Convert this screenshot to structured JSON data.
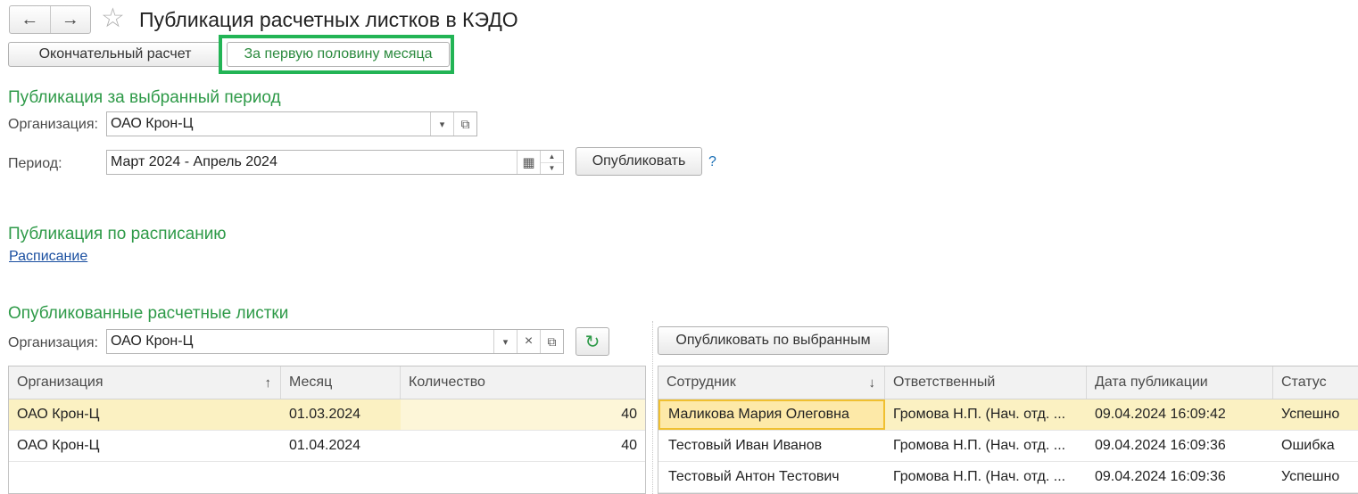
{
  "header": {
    "back": "←",
    "forward": "→",
    "star": "☆",
    "title": "Публикация расчетных листков в КЭДО"
  },
  "tabs": [
    {
      "label": "Окончательный расчет"
    },
    {
      "label": "За первую половину месяца"
    }
  ],
  "period_section": {
    "title": "Публикация за выбранный период",
    "org_label": "Организация:",
    "org_value": "ОАО Крон-Ц",
    "period_label": "Период:",
    "period_value": "Март 2024 - Апрель 2024",
    "publish_button": "Опубликовать",
    "help": "?"
  },
  "schedule_section": {
    "title": "Публикация по расписанию",
    "link": "Расписание"
  },
  "published_section": {
    "title": "Опубликованные расчетные листки",
    "org_label": "Организация:",
    "org_value": "ОАО Крон-Ц",
    "publish_selected_button": "Опубликовать по выбранным"
  },
  "left_table": {
    "columns": [
      "Организация",
      "Месяц",
      "Количество"
    ],
    "sort_marker": "↑",
    "rows": [
      {
        "org": "ОАО Крон-Ц",
        "month": "01.03.2024",
        "count": "40"
      },
      {
        "org": "ОАО Крон-Ц",
        "month": "01.04.2024",
        "count": "40"
      }
    ]
  },
  "right_table": {
    "columns": [
      "Сотрудник",
      "Ответственный",
      "Дата публикации",
      "Статус"
    ],
    "sort_marker": "↓",
    "rows": [
      {
        "employee": "Маликова Мария Олеговна",
        "responsible": "Громова Н.П. (Нач. отд. ...",
        "date": "09.04.2024 16:09:42",
        "status": "Успешно"
      },
      {
        "employee": "Тестовый Иван Иванов",
        "responsible": "Громова Н.П. (Нач. отд. ...",
        "date": "09.04.2024 16:09:36",
        "status": "Ошибка"
      },
      {
        "employee": "Тестовый Антон Тестович",
        "responsible": "Громова Н.П. (Нач. отд. ...",
        "date": "09.04.2024 16:09:36",
        "status": "Успешно"
      }
    ]
  },
  "icons": {
    "dropdown": "▾",
    "open": "⧉",
    "calendar": "▦",
    "clear": "×",
    "refresh": "↻"
  },
  "colors": {
    "accent_green": "#2e9a48",
    "highlight_frame": "#22b455",
    "selected_row": "#fbf1c2",
    "link": "#1a4fa0"
  }
}
